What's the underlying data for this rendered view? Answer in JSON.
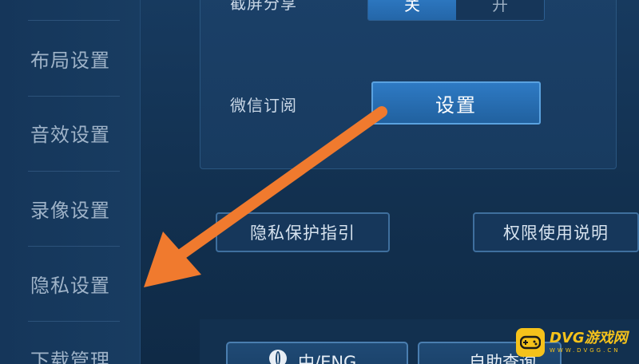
{
  "sidebar": {
    "items": [
      {
        "label": "布局设置"
      },
      {
        "label": "音效设置"
      },
      {
        "label": "录像设置"
      },
      {
        "label": "隐私设置"
      },
      {
        "label": "下载管理"
      }
    ]
  },
  "main": {
    "screenshot_share": {
      "label": "截屏分享",
      "options": [
        "关",
        "开"
      ],
      "selected": "关"
    },
    "wechat_subscribe": {
      "label": "微信订阅",
      "button_label": "设置"
    },
    "privacy_guide_label": "隐私保护指引",
    "permission_info_label": "权限使用说明"
  },
  "bottom": {
    "language_label": "中/ENG",
    "self_service_label": "自助查询"
  },
  "watermark": {
    "title": "DVG游戏网",
    "sub": "WWW.DVGG.CN"
  },
  "colors": {
    "arrow": "#f07a2e",
    "accent": "#2e7ac4",
    "watermark": "#f5c21b"
  }
}
